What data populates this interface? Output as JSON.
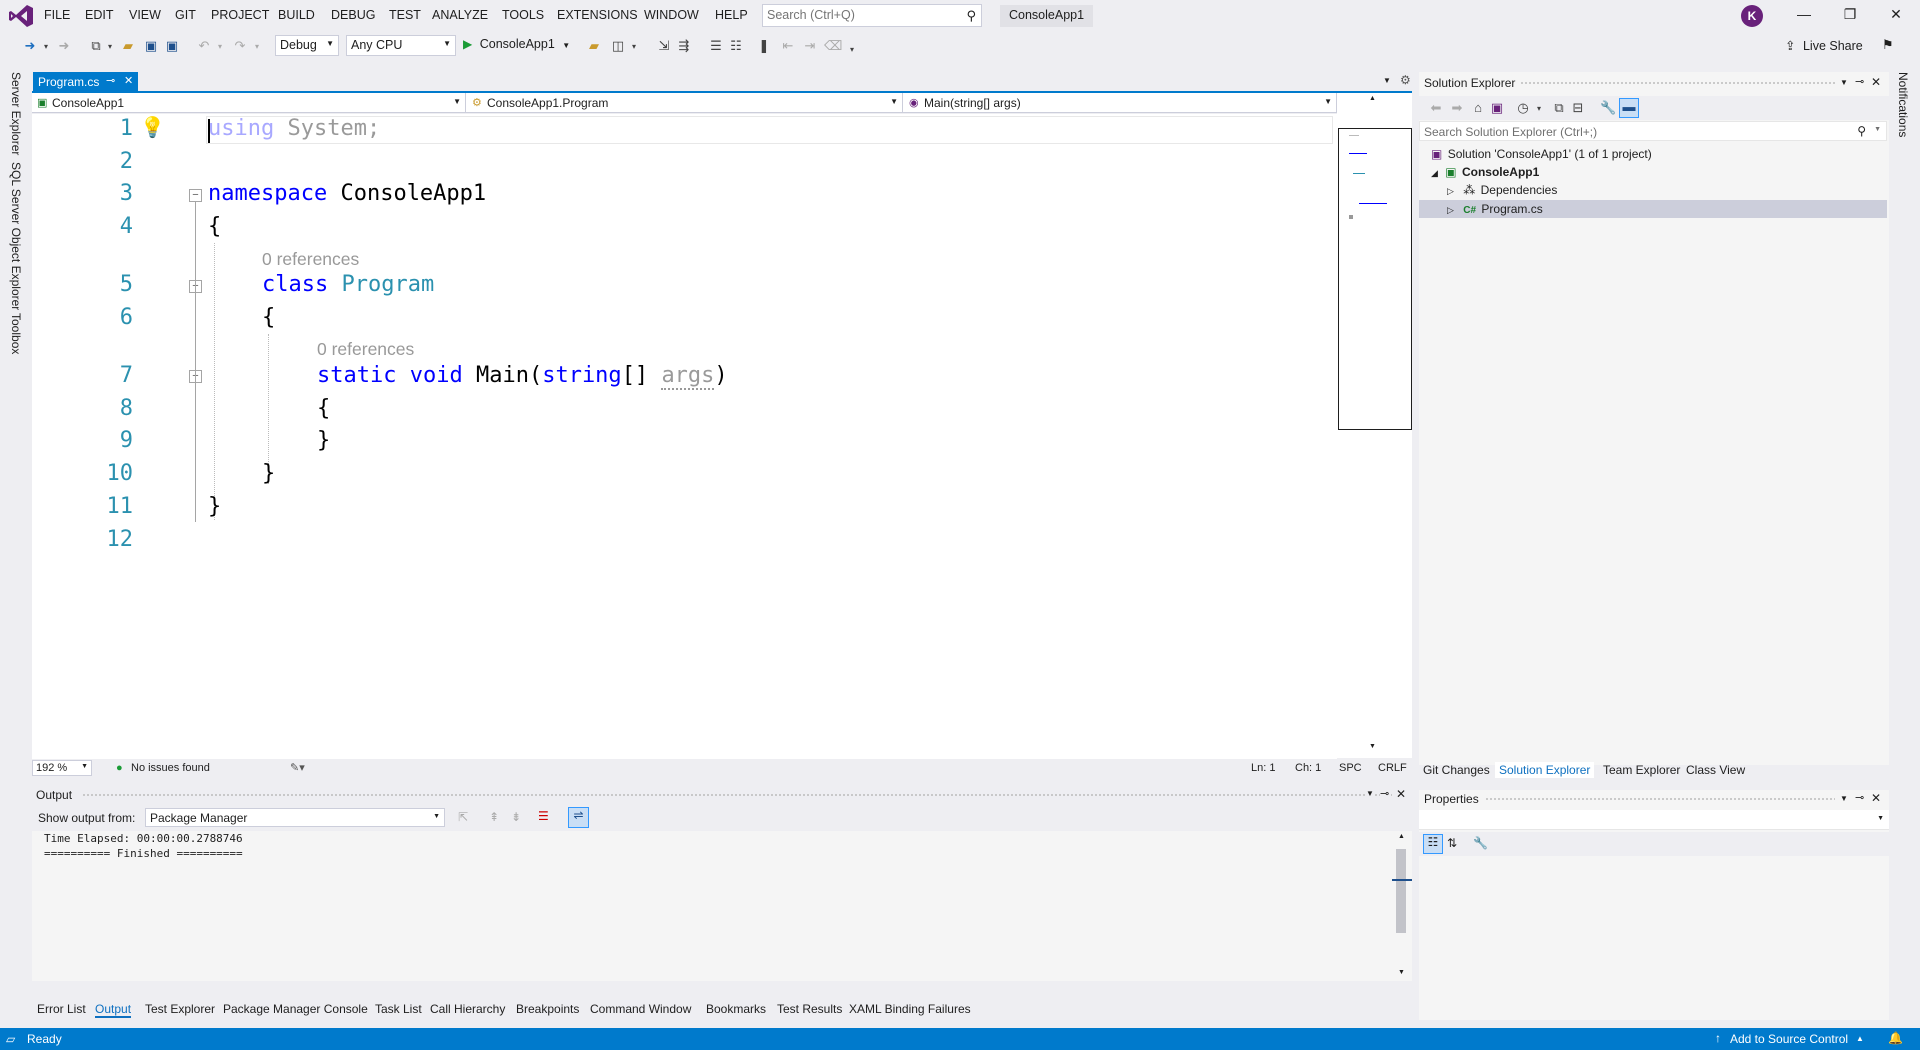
{
  "menu": [
    "FILE",
    "EDIT",
    "VIEW",
    "GIT",
    "PROJECT",
    "BUILD",
    "DEBUG",
    "TEST",
    "ANALYZE",
    "TOOLS",
    "EXTENSIONS",
    "WINDOW",
    "HELP"
  ],
  "search": {
    "placeholder": "Search (Ctrl+Q)"
  },
  "solution_name": "ConsoleApp1",
  "avatar_initial": "K",
  "toolbar": {
    "config": "Debug",
    "platform": "Any CPU",
    "run_target": "ConsoleApp1",
    "live_share": "Live Share"
  },
  "left_tabs": [
    "Server Explorer",
    "SQL Server Object Explorer",
    "Toolbox"
  ],
  "right_tab": "Notifications",
  "doc_tab": {
    "title": "Program.cs",
    "pin": "⊸",
    "close": "✕"
  },
  "navbar": {
    "project": "ConsoleApp1",
    "type": "ConsoleApp1.Program",
    "member": "Main(string[] args)"
  },
  "code": {
    "line_numbers": [
      "1",
      "2",
      "3",
      "4",
      "5",
      "6",
      "7",
      "8",
      "9",
      "10",
      "11",
      "12"
    ],
    "l1_kw": "using",
    "l1_rest": " System;",
    "l3_kw": "namespace",
    "l3_name": " ConsoleApp1",
    "brace_open": "{",
    "brace_close": "}",
    "refs": "0 references",
    "l5_kw": "class",
    "l5_name": "Program",
    "l7_static": "static",
    "l7_void": "void",
    "l7_main": "Main(",
    "l7_string": "string",
    "l7_arr": "[] ",
    "l7_args": "args",
    "l7_close": ")"
  },
  "editor_status": {
    "zoom": "192 %",
    "issues": "No issues found",
    "ln": "Ln: 1",
    "ch": "Ch: 1",
    "spc": "SPC",
    "eol": "CRLF"
  },
  "output": {
    "title": "Output",
    "show_from_label": "Show output from:",
    "source": "Package Manager",
    "lines": "Time Elapsed: 00:00:00.2788746\n========== Finished =========="
  },
  "bottom_tabs": [
    "Error List",
    "Output",
    "Test Explorer",
    "Package Manager Console",
    "Task List",
    "Call Hierarchy",
    "Breakpoints",
    "Command Window",
    "Bookmarks",
    "Test Results",
    "XAML Binding Failures"
  ],
  "solution_explorer": {
    "title": "Solution Explorer",
    "search_placeholder": "Search Solution Explorer (Ctrl+;)",
    "solution": "Solution 'ConsoleApp1' (1 of 1 project)",
    "project": "ConsoleApp1",
    "dependencies": "Dependencies",
    "file": "Program.cs"
  },
  "se_tabs": [
    "Git Changes",
    "Solution Explorer",
    "Team Explorer",
    "Class View"
  ],
  "properties": {
    "title": "Properties"
  },
  "statusbar": {
    "ready": "Ready",
    "source_control": "Add to Source Control"
  },
  "colors": {
    "accent": "#007acc",
    "keyword": "#0000ff",
    "type": "#2b91af",
    "line_number": "#2b91af"
  }
}
